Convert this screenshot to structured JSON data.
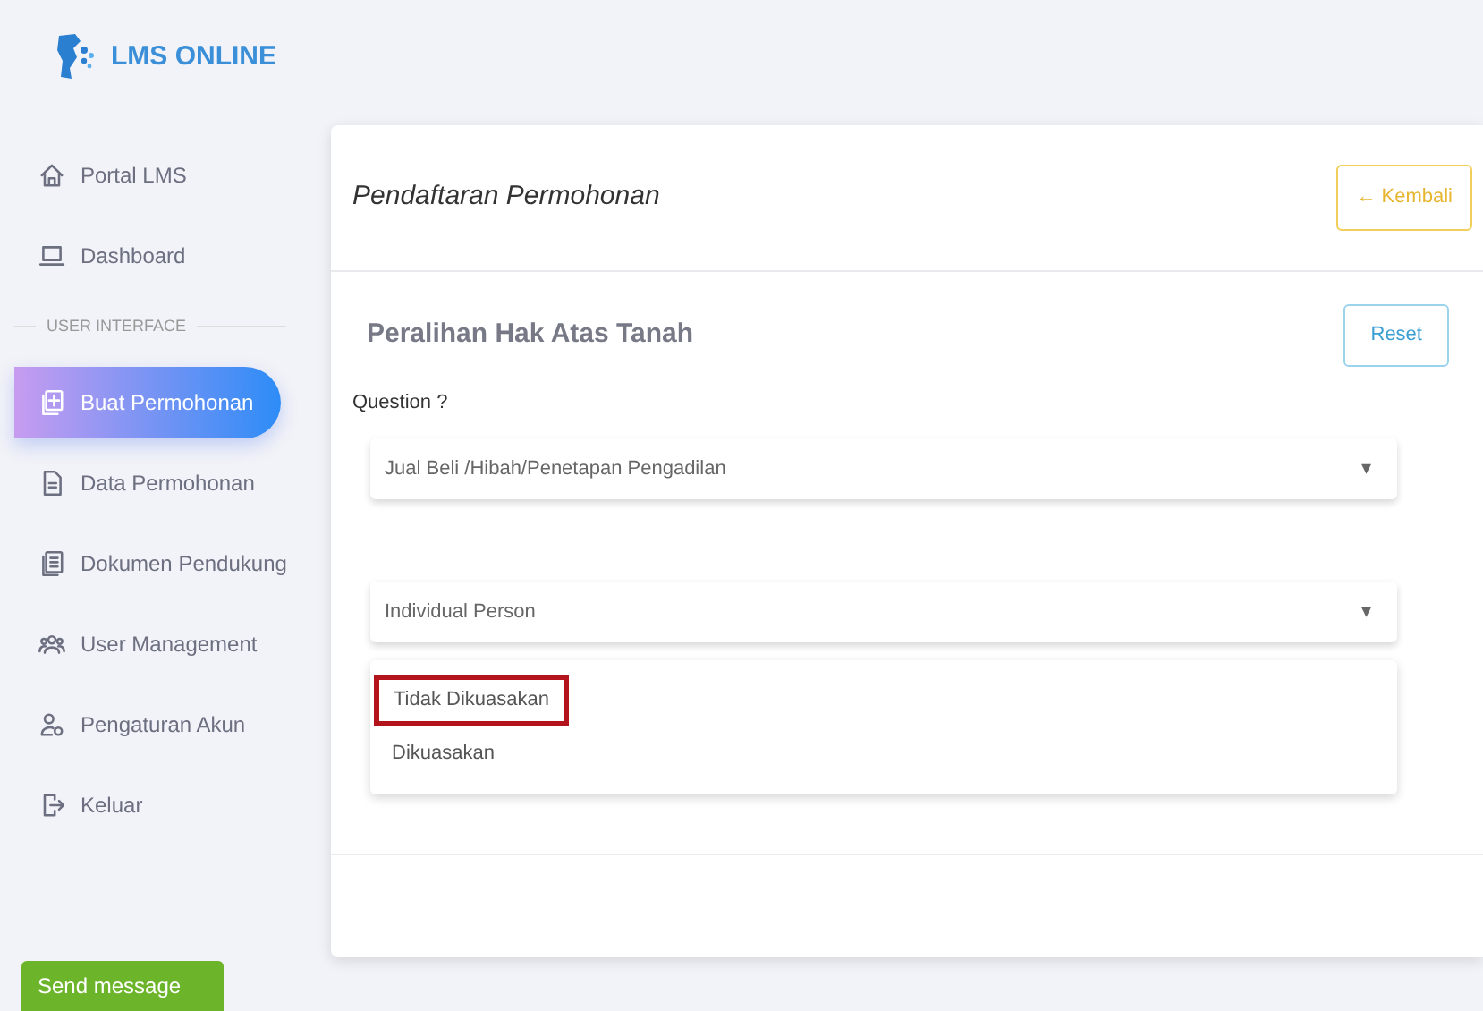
{
  "brand": {
    "name": "LMS ONLINE"
  },
  "sidebar": {
    "items": [
      {
        "kind": "link",
        "label": "Portal LMS",
        "selected": false
      },
      {
        "kind": "link",
        "label": "Dashboard",
        "selected": false
      },
      {
        "kind": "heading",
        "label": "USER INTERFACE"
      },
      {
        "kind": "link",
        "label": "Buat Permohonan",
        "selected": true
      },
      {
        "kind": "link",
        "label": "Data Permohonan",
        "selected": false
      },
      {
        "kind": "link",
        "label": "Dokumen Pendukung",
        "selected": false
      },
      {
        "kind": "link",
        "label": "User Management",
        "selected": false
      },
      {
        "kind": "link",
        "label": "Pengaturan Akun",
        "selected": false
      },
      {
        "kind": "link",
        "label": "Keluar",
        "selected": false
      }
    ]
  },
  "send_message": {
    "label": "Send message"
  },
  "card": {
    "title": "Pendaftaran Permohonan",
    "back_button": "← Kembali",
    "section_title": "Peralihan Hak Atas Tanah",
    "reset_button": "Reset",
    "question_label": "Question ?",
    "selects": [
      {
        "value": "Jual Beli /Hibah/Penetapan Pengadilan",
        "arrow": "▾"
      },
      {
        "value": "Individual Person",
        "arrow": "▾"
      }
    ],
    "dropdown_options": [
      {
        "label": "Tidak Dikuasakan",
        "highlighted": true
      },
      {
        "label": "Dikuasakan",
        "highlighted": false
      }
    ]
  }
}
